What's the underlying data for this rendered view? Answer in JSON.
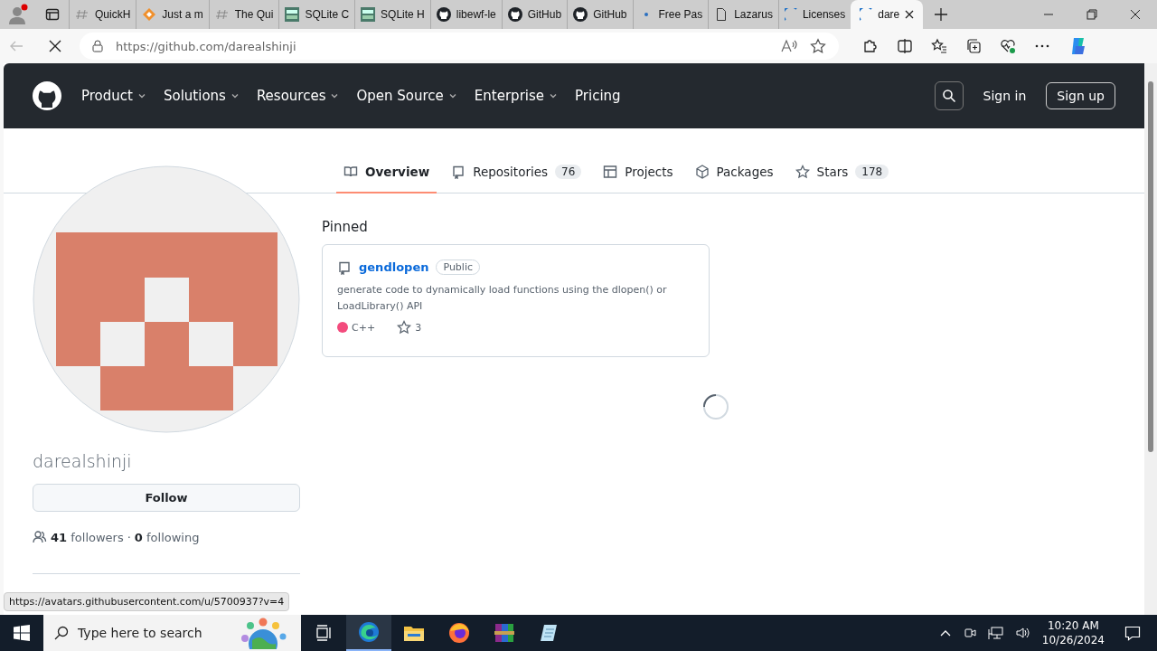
{
  "browser": {
    "tabs": [
      {
        "title": "QuickH",
        "kind": "hash",
        "selected": false
      },
      {
        "title": "Just a m",
        "kind": "diamond",
        "selected": false
      },
      {
        "title": "The Qui",
        "kind": "hash",
        "selected": false
      },
      {
        "title": "SQLite C",
        "kind": "sqlite",
        "selected": false
      },
      {
        "title": "SQLite H",
        "kind": "sqlite",
        "selected": false
      },
      {
        "title": "libewf-le",
        "kind": "github",
        "selected": false
      },
      {
        "title": "GitHub",
        "kind": "github",
        "selected": false
      },
      {
        "title": "GitHub",
        "kind": "github",
        "selected": false
      },
      {
        "title": "Free Pas",
        "kind": "dot",
        "selected": false
      },
      {
        "title": "Lazarus",
        "kind": "page",
        "selected": false
      },
      {
        "title": "Licenses",
        "kind": "loading",
        "selected": false
      },
      {
        "title": "dare",
        "kind": "loading",
        "selected": true
      }
    ],
    "address": {
      "url_host": "https://github.com",
      "url_path": "/darealshinji"
    }
  },
  "header": {
    "nav": [
      {
        "label": "Product",
        "dropdown": true
      },
      {
        "label": "Solutions",
        "dropdown": true
      },
      {
        "label": "Resources",
        "dropdown": true
      },
      {
        "label": "Open Source",
        "dropdown": true
      },
      {
        "label": "Enterprise",
        "dropdown": true
      },
      {
        "label": "Pricing",
        "dropdown": false
      }
    ],
    "sign_in": "Sign in",
    "sign_up": "Sign up"
  },
  "profile_tabs": [
    {
      "label": "Overview",
      "kind": "book",
      "selected": true
    },
    {
      "label": "Repositories",
      "kind": "repo",
      "count": "76",
      "selected": false
    },
    {
      "label": "Projects",
      "kind": "table",
      "selected": false
    },
    {
      "label": "Packages",
      "kind": "package",
      "selected": false
    },
    {
      "label": "Stars",
      "kind": "star",
      "count": "178",
      "selected": false
    }
  ],
  "profile": {
    "username": "darealshinji",
    "follow": "Follow",
    "followers_count": "41",
    "followers_label": "followers",
    "separator": "·",
    "following_count": "0",
    "following_label": "following"
  },
  "pinned": {
    "heading": "Pinned",
    "repos": [
      {
        "name": "gendlopen",
        "visibility": "Public",
        "description": "generate code to dynamically load functions using the dlopen() or LoadLibrary() API",
        "language": "C++",
        "color": "#f34b7d",
        "stars": "3"
      }
    ]
  },
  "status_url": "https://avatars.githubusercontent.com/u/5700937?v=4",
  "taskbar": {
    "search_placeholder": "Type here to search",
    "time": "10:20 AM",
    "date": "10/26/2024"
  }
}
